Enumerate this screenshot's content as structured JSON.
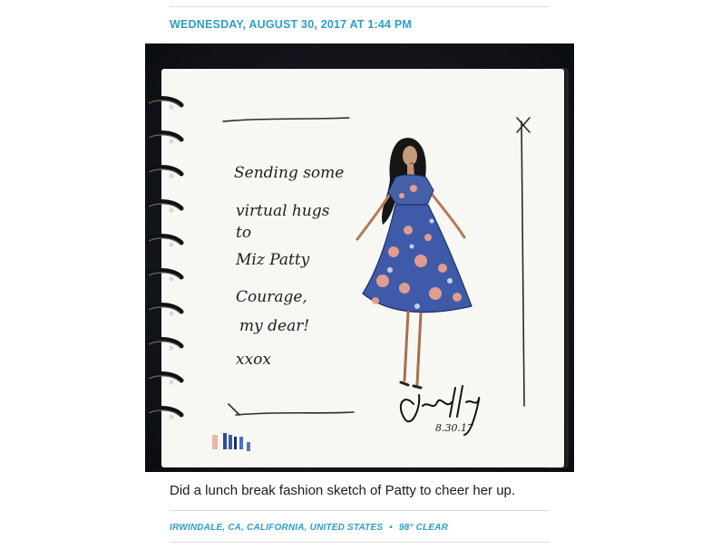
{
  "entry": {
    "date": "WEDNESDAY, AUGUST 30, 2017 AT 1:44 PM",
    "caption": "Did a lunch break fashion sketch of Patty to cheer her up.",
    "location": "IRWINDALE, CA, CALIFORNIA, UNITED STATES",
    "separator": "•",
    "weather": "98° CLEAR"
  },
  "sketch": {
    "handwritten_lines": [
      "Sending some",
      "virtual hugs",
      "to",
      "Miz Patty",
      "Courage,",
      "my dear!",
      "xxox"
    ],
    "signature_date": "8.30.17"
  },
  "colors": {
    "accent": "#2c9fc8",
    "dress": "#3f5aa8",
    "flowers": "#f2a48c"
  }
}
